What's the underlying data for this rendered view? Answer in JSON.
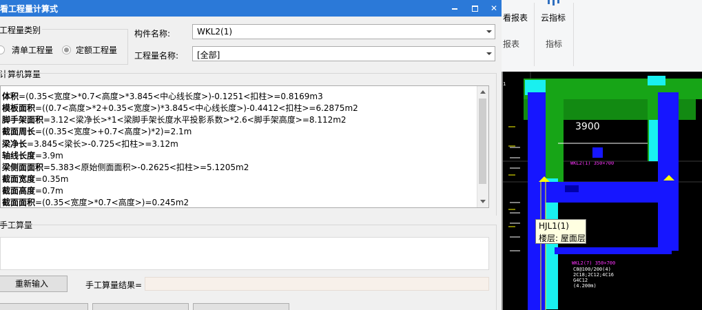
{
  "dialog": {
    "title": "看工程量计算式",
    "group_label": "工程量类别",
    "radio_list": "清单工程量",
    "radio_quota": "定额工程量",
    "quota_selected": true,
    "component_label": "构件名称:",
    "component_value": "WKL2(1)",
    "quantity_label": "工程量名称:",
    "quantity_value": "[全部]",
    "computer_label": "计算机算量",
    "lines": [
      {
        "name": "体积",
        "expr": "=(0.35<宽度>*0.7<高度>*3.845<中心线长度>)-0.1251<扣柱>=0.8169m3"
      },
      {
        "name": "模板面积",
        "expr": "=((0.7<高度>*2+0.35<宽度>)*3.845<中心线长度>)-0.4412<扣柱>=6.2875m2"
      },
      {
        "name": "脚手架面积",
        "expr": "=3.12<梁净长>*1<梁脚手架长度水平投影系数>*2.6<脚手架高度>=8.112m2"
      },
      {
        "name": "截面周长",
        "expr": "=((0.35<宽度>+0.7<高度>)*2)=2.1m"
      },
      {
        "name": "梁净长",
        "expr": "=3.845<梁长>-0.725<扣柱>=3.12m"
      },
      {
        "name": "轴线长度",
        "expr": "=3.9m"
      },
      {
        "name": "梁侧面面积",
        "expr": "=5.383<原始侧面面积>-0.2625<扣柱>=5.1205m2"
      },
      {
        "name": "截面宽度",
        "expr": "=0.35m"
      },
      {
        "name": "截面高度",
        "expr": "=0.7m"
      },
      {
        "name": "截面面积",
        "expr": "=(0.35<宽度>*0.7<高度>)=0.245m2"
      }
    ],
    "manual_label": "手工算量",
    "reinput_button": "重新输入",
    "manual_result_label": "手工算量结果="
  },
  "ribbon": {
    "view_report": "看报表",
    "cloud_index": "云指标",
    "group_report": "报表",
    "group_index": "指标"
  },
  "viewport": {
    "dim_label": "3900",
    "tooltip_name": "HJL1(1)",
    "tooltip_floor": "楼层: 屋面层",
    "colors": {
      "green": "#17a517",
      "blue": "#1616ff",
      "cyan": "#19f0f0",
      "yellow": "#ffff00",
      "magenta": "#ff33ff"
    }
  }
}
